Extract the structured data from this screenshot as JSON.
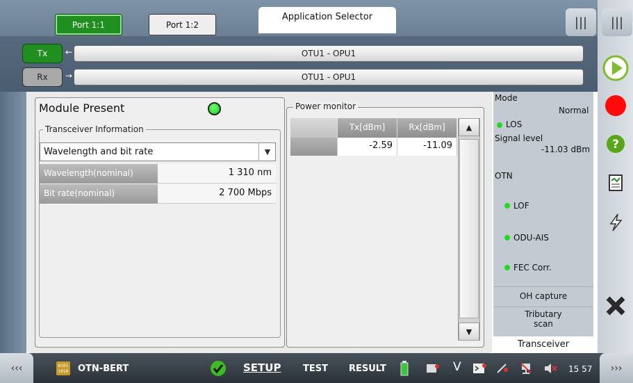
{
  "header": {
    "port_tabs": [
      {
        "label": "Port 1:1",
        "active": true
      },
      {
        "label": "Port 1:2",
        "active": false
      }
    ],
    "app_selector": "Application Selector"
  },
  "signal_rows": [
    {
      "button": "Tx",
      "label": "OTU1 - OPU1"
    },
    {
      "button": "Rx",
      "label": "OTU1 - OPU1"
    }
  ],
  "module": {
    "title": "Module Present",
    "status_color": "#1ecb1e",
    "transceiver_legend": "Transceiver Information",
    "select_value": "Wavelength and bit rate",
    "rows": [
      {
        "key": "Wavelength(nominal)",
        "value": "1 310 nm"
      },
      {
        "key": "Bit rate(nominal)",
        "value": "2 700 Mbps"
      }
    ]
  },
  "power_monitor": {
    "legend": "Power monitor",
    "columns": [
      "",
      "Tx[dBm]",
      "Rx[dBm]"
    ],
    "row": [
      "",
      "-2.59",
      "-11.09"
    ]
  },
  "status": {
    "mode_label": "Mode",
    "mode_value": "Normal",
    "los": "LOS",
    "signal_level_label": "Signal level",
    "signal_level_value": "-11.03 dBm",
    "otn_label": "OTN",
    "lof": "LOF",
    "odu_ais": "ODU-AIS",
    "fec_corr": "FEC Corr.",
    "oh_capture": "OH capture",
    "tributary_scan": "Tributary scan",
    "transceiver": "Transceiver",
    "indicator_color": "#23d823"
  },
  "right_toolbar": {
    "menu_icon": "vertical-bars-icon",
    "icons": [
      "play-icon",
      "record-icon",
      "help-icon",
      "report-icon",
      "error-inject-icon",
      "close-icon"
    ],
    "colors": {
      "record": "#ff0b0b",
      "help": "#5aa619",
      "play": "#7dbd2b"
    }
  },
  "bottom_bar": {
    "app_name": "OTN-BERT",
    "setup": "SETUP",
    "test": "TEST",
    "result": "RESULT",
    "time": "15 57",
    "left_nav": "‹‹‹",
    "right_nav": "›››"
  }
}
